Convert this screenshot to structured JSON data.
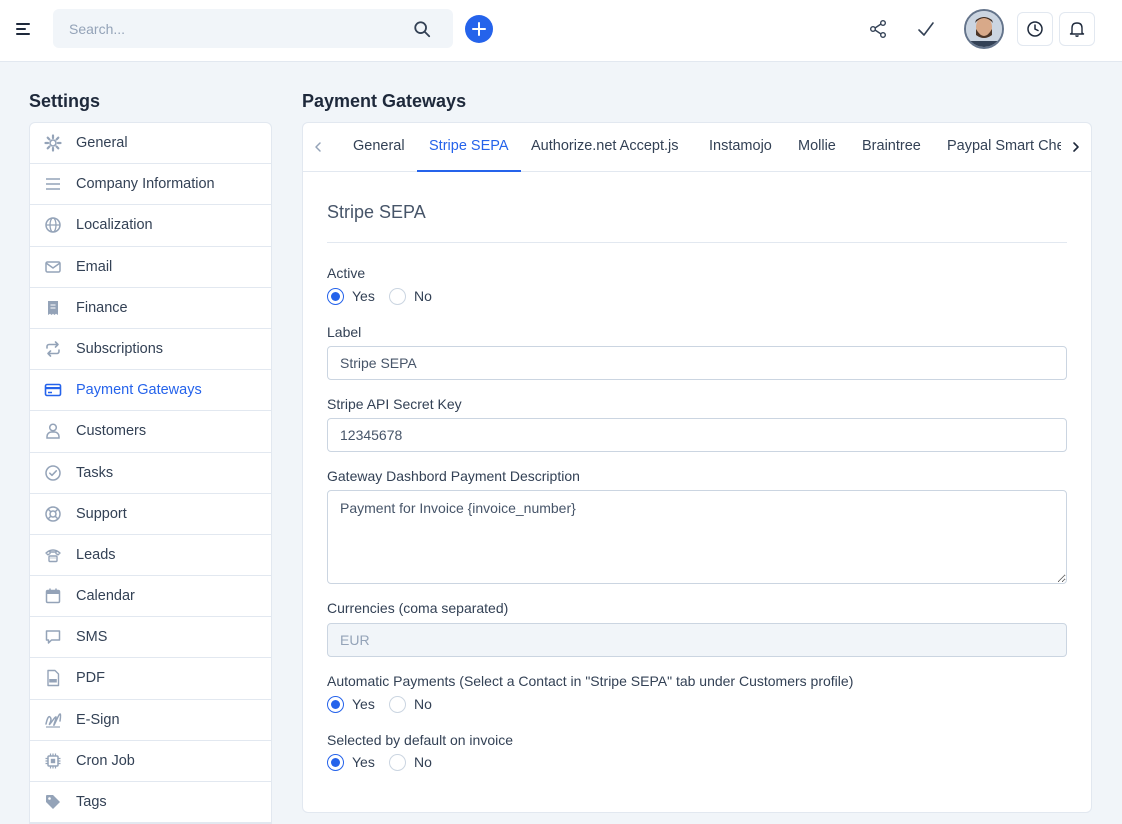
{
  "topbar": {
    "search_placeholder": "Search...",
    "icons": [
      "menu-icon",
      "search-icon",
      "plus-icon",
      "share-icon",
      "check-icon",
      "clock-icon",
      "bell-icon"
    ]
  },
  "sidebar": {
    "title": "Settings",
    "active_color": "#2563eb",
    "items": [
      {
        "label": "General",
        "icon": "gear-icon"
      },
      {
        "label": "Company Information",
        "icon": "lines-icon"
      },
      {
        "label": "Localization",
        "icon": "globe-icon"
      },
      {
        "label": "Email",
        "icon": "envelope-icon"
      },
      {
        "label": "Finance",
        "icon": "receipt-icon"
      },
      {
        "label": "Subscriptions",
        "icon": "repeat-icon"
      },
      {
        "label": "Payment Gateways",
        "icon": "credit-card-icon",
        "active": true
      },
      {
        "label": "Customers",
        "icon": "user-icon"
      },
      {
        "label": "Tasks",
        "icon": "check-circle-icon"
      },
      {
        "label": "Support",
        "icon": "lifebuoy-icon"
      },
      {
        "label": "Leads",
        "icon": "phone-icon"
      },
      {
        "label": "Calendar",
        "icon": "calendar-icon"
      },
      {
        "label": "SMS",
        "icon": "chat-icon"
      },
      {
        "label": "PDF",
        "icon": "pdf-file-icon"
      },
      {
        "label": "E-Sign",
        "icon": "signature-icon"
      },
      {
        "label": "Cron Job",
        "icon": "chip-icon"
      },
      {
        "label": "Tags",
        "icon": "tag-icon"
      }
    ]
  },
  "main": {
    "title": "Payment Gateways",
    "tabs": [
      {
        "label": "General"
      },
      {
        "label": "Stripe SEPA",
        "active": true
      },
      {
        "label": "Authorize.net Accept.js"
      },
      {
        "label": "Instamojo"
      },
      {
        "label": "Mollie"
      },
      {
        "label": "Braintree"
      },
      {
        "label": "Paypal Smart Checkout"
      }
    ],
    "form": {
      "title": "Stripe SEPA",
      "active": {
        "label": "Active",
        "yes": "Yes",
        "no": "No",
        "selected": "yes"
      },
      "label_field": {
        "label": "Label",
        "value": "Stripe SEPA"
      },
      "secret_key": {
        "label": "Stripe API Secret Key",
        "value": "12345678"
      },
      "description": {
        "label": "Gateway Dashbord Payment Description",
        "value": "Payment for Invoice {invoice_number}"
      },
      "currencies": {
        "label": "Currencies (coma separated)",
        "value": "EUR"
      },
      "automatic_payments": {
        "label": "Automatic Payments (Select a Contact in \"Stripe SEPA\" tab under Customers profile)",
        "yes": "Yes",
        "no": "No",
        "selected": "yes"
      },
      "default_on_invoice": {
        "label": "Selected by default on invoice",
        "yes": "Yes",
        "no": "No",
        "selected": "yes"
      }
    }
  }
}
